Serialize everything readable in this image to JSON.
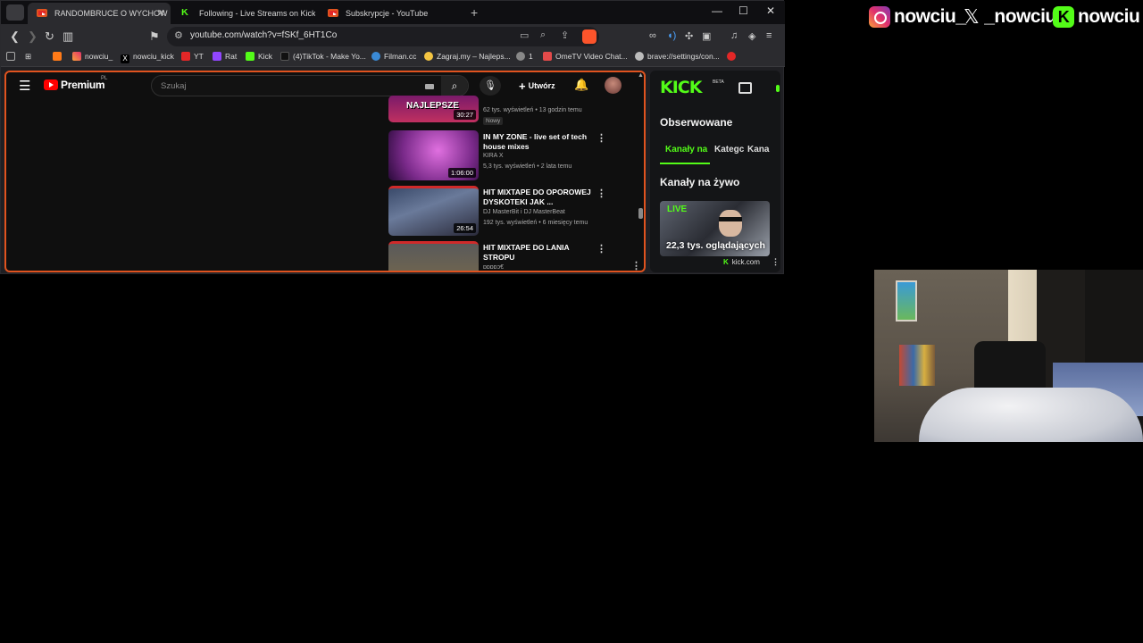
{
  "browser": {
    "tabs": [
      {
        "label": "RANDOMBRUCE O WYCHOW",
        "favicon": "youtube-icon",
        "active": true
      },
      {
        "label": "Following - Live Streams on Kick",
        "favicon": "kick-icon",
        "active": false
      },
      {
        "label": "Subskrypcje - YouTube",
        "favicon": "youtube-icon",
        "active": false
      }
    ],
    "url": "youtube.com/watch?v=fSKf_6HT1Co",
    "bookmarks": [
      "nowciu_",
      "nowciu_kick",
      "YT",
      "Rat",
      "Kick",
      "(4)TikTok - Make Yo...",
      "Filman.cc",
      "Zagraj.my – Najleps...",
      "1",
      "OmeTV Video Chat...",
      "brave://settings/con..."
    ]
  },
  "youtube": {
    "logo_text": "Premium",
    "logo_region": "PL",
    "search_placeholder": "Szukaj",
    "create_label": "Utwórz",
    "videos": [
      {
        "thumb_text": "NAJLEPSZE",
        "duration": "30:27",
        "title": "",
        "channel": "",
        "meta": "62 tys. wyświetleń • 13 godzin temu",
        "badge": "Nowy"
      },
      {
        "thumb_text": "",
        "duration": "1:06:00",
        "title": "IN MY ZONE - live set of tech house mixes",
        "channel": "KIRA X",
        "meta": "5,3 tys. wyświetleń • 2 lata temu",
        "badge": ""
      },
      {
        "thumb_text": "",
        "duration": "26:54",
        "title": "HIT MIXTAPE DO OPOROWEJ DYSKOTEKI JAK ...",
        "channel": "DJ MasterBit i DJ MasterBeat",
        "meta": "192 tys. wyświetleń • 6 miesięcy temu",
        "badge": ""
      },
      {
        "thumb_text": "",
        "duration": "",
        "title": "HIT MIXTAPE DO LANIA STROPU",
        "channel": "ɒɒɒɒɔ€",
        "meta": "",
        "badge": ""
      }
    ]
  },
  "kick_panel": {
    "logo": "KICK",
    "beta": "BETA",
    "heading": "Obserwowane",
    "tabs": [
      "Kanały na",
      "Kategc",
      "Kana"
    ],
    "live_heading": "Kanały na żywo",
    "live_badge": "LIVE",
    "viewers": "22,3 tys. oglądających",
    "domain": "kick.com"
  },
  "overlay": {
    "instagram": "nowciu_",
    "x": "_nowciu",
    "kick": "nowciu"
  },
  "colors": {
    "kick_green": "#53fc18",
    "youtube_red": "#ff0000",
    "focus_border": "#e0531f"
  }
}
